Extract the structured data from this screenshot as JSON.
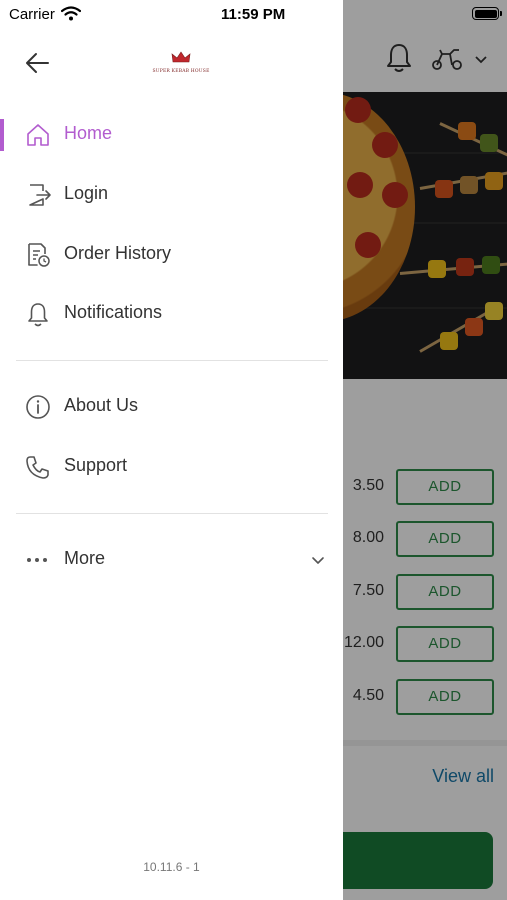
{
  "status_bar": {
    "carrier": "Carrier",
    "time": "11:59 PM"
  },
  "drawer": {
    "logo_text": "SUPER KEBAB HOUSE",
    "menu": [
      {
        "label": "Home",
        "icon": "home-icon",
        "active": true
      },
      {
        "label": "Login",
        "icon": "login-icon"
      },
      {
        "label": "Order History",
        "icon": "order-history-icon"
      },
      {
        "label": "Notifications",
        "icon": "bell-icon"
      },
      {
        "label": "About Us",
        "icon": "info-icon"
      },
      {
        "label": "Support",
        "icon": "phone-icon"
      },
      {
        "label": "More",
        "icon": "more-dots-icon"
      }
    ],
    "version": "10.11.6 - 1",
    "accent_color": "#b25ccf"
  },
  "background": {
    "items": [
      {
        "price": "3.50",
        "button": "ADD"
      },
      {
        "price": "8.00",
        "button": "ADD"
      },
      {
        "price": "7.50",
        "button": "ADD"
      },
      {
        "price": "12.00",
        "button": "ADD"
      },
      {
        "price": "4.50",
        "button": "ADD"
      }
    ],
    "view_all": "View all",
    "accent_color": "#2e8b4a",
    "link_color": "#1976a8"
  }
}
